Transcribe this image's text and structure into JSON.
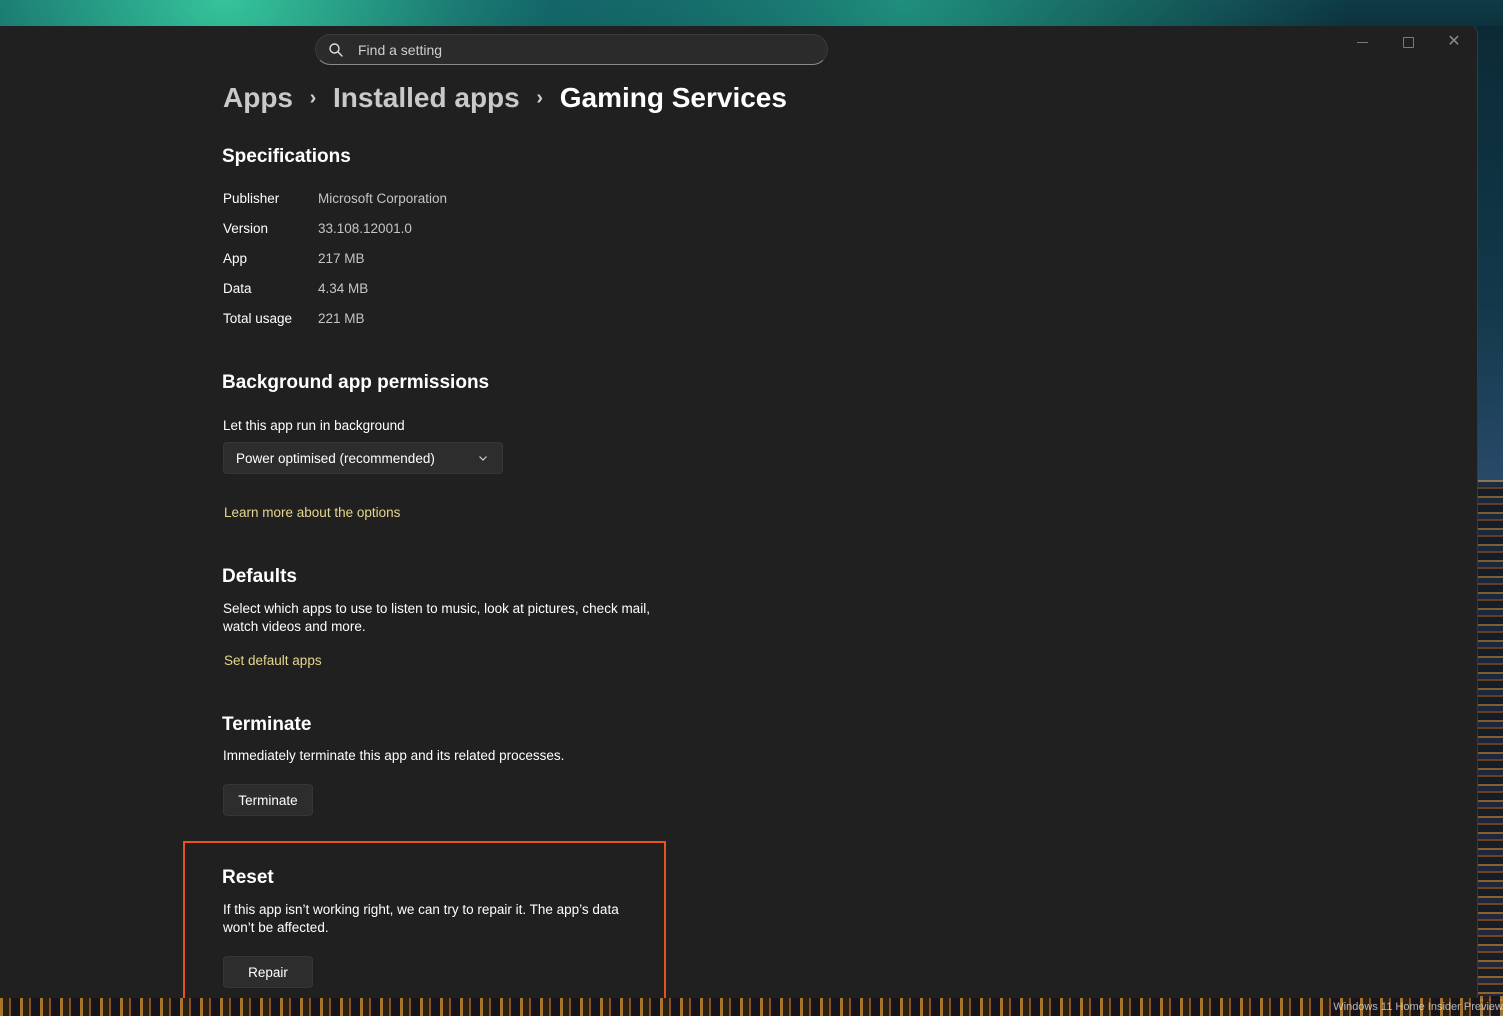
{
  "search": {
    "placeholder": "Find a setting"
  },
  "breadcrumb": [
    {
      "label": "Apps"
    },
    {
      "label": "Installed apps"
    },
    {
      "label": "Gaming Services"
    }
  ],
  "specifications": {
    "title": "Specifications",
    "rows": [
      {
        "label": "Publisher",
        "value": "Microsoft Corporation"
      },
      {
        "label": "Version",
        "value": "33.108.12001.0"
      },
      {
        "label": "App",
        "value": "217 MB"
      },
      {
        "label": "Data",
        "value": "4.34 MB"
      },
      {
        "label": "Total usage",
        "value": "221 MB"
      }
    ]
  },
  "background": {
    "title": "Background app permissions",
    "label": "Let this app run in background",
    "selected": "Power optimised (recommended)",
    "link": "Learn more about the options"
  },
  "defaults": {
    "title": "Defaults",
    "description": "Select which apps to use to listen to music, look at pictures, check mail, watch videos and more.",
    "link": "Set default apps"
  },
  "terminate": {
    "title": "Terminate",
    "description": "Immediately terminate this app and its related processes.",
    "button": "Terminate"
  },
  "reset": {
    "title": "Reset",
    "description": "If this app isn’t working right, we can try to repair it. The app’s data won’t be affected.",
    "button": "Repair"
  },
  "watermark": "Windows 11 Home Insider Preview",
  "colors": {
    "highlight": "#e8521c",
    "link": "#e6d68c",
    "window_bg": "#202020"
  }
}
